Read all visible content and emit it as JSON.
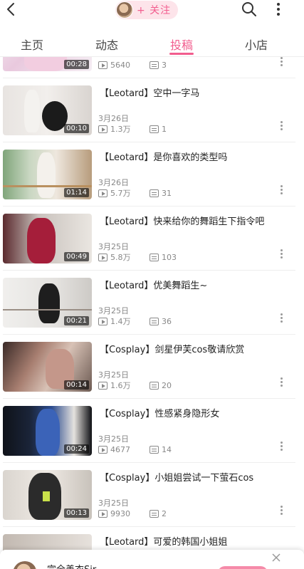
{
  "header": {
    "follow_label": "+ 关注"
  },
  "tabs": [
    {
      "label": "主页",
      "active": false
    },
    {
      "label": "动态",
      "active": false
    },
    {
      "label": "投稿",
      "active": true
    },
    {
      "label": "小店",
      "active": false
    }
  ],
  "videos": [
    {
      "title": "",
      "date": "",
      "duration": "00:28",
      "views": "5640",
      "comments": "3"
    },
    {
      "title": "【Leotard】空中一字马",
      "date": "3月26日",
      "duration": "00:10",
      "views": "1.3万",
      "comments": "1"
    },
    {
      "title": "【Leotard】是你喜欢的类型吗",
      "date": "3月26日",
      "duration": "01:14",
      "views": "5.7万",
      "comments": "31"
    },
    {
      "title": "【Leotard】快来给你的舞蹈生下指令吧",
      "date": "3月25日",
      "duration": "00:49",
      "views": "5.8万",
      "comments": "103"
    },
    {
      "title": "【Leotard】优美舞蹈生~",
      "date": "3月25日",
      "duration": "00:21",
      "views": "1.4万",
      "comments": "36"
    },
    {
      "title": "【Cosplay】剑星伊芙cos敬请欣赏",
      "date": "3月25日",
      "duration": "00:14",
      "views": "1.6万",
      "comments": "20"
    },
    {
      "title": "【Cosplay】性感紧身隐形女",
      "date": "3月25日",
      "duration": "00:24",
      "views": "4677",
      "comments": "14"
    },
    {
      "title": "【Cosplay】小姐姐尝试一下萤石cos",
      "date": "3月25日",
      "duration": "00:13",
      "views": "9930",
      "comments": "2"
    },
    {
      "title": "【Leotard】可爱的韩国小姐姐",
      "date": "",
      "duration": "",
      "views": "",
      "comments": ""
    }
  ],
  "bottom_bar": {
    "name": "完全善衣Sir"
  },
  "colors": {
    "accent": "#f25d8e",
    "follow_bg": "#fde4ea"
  }
}
